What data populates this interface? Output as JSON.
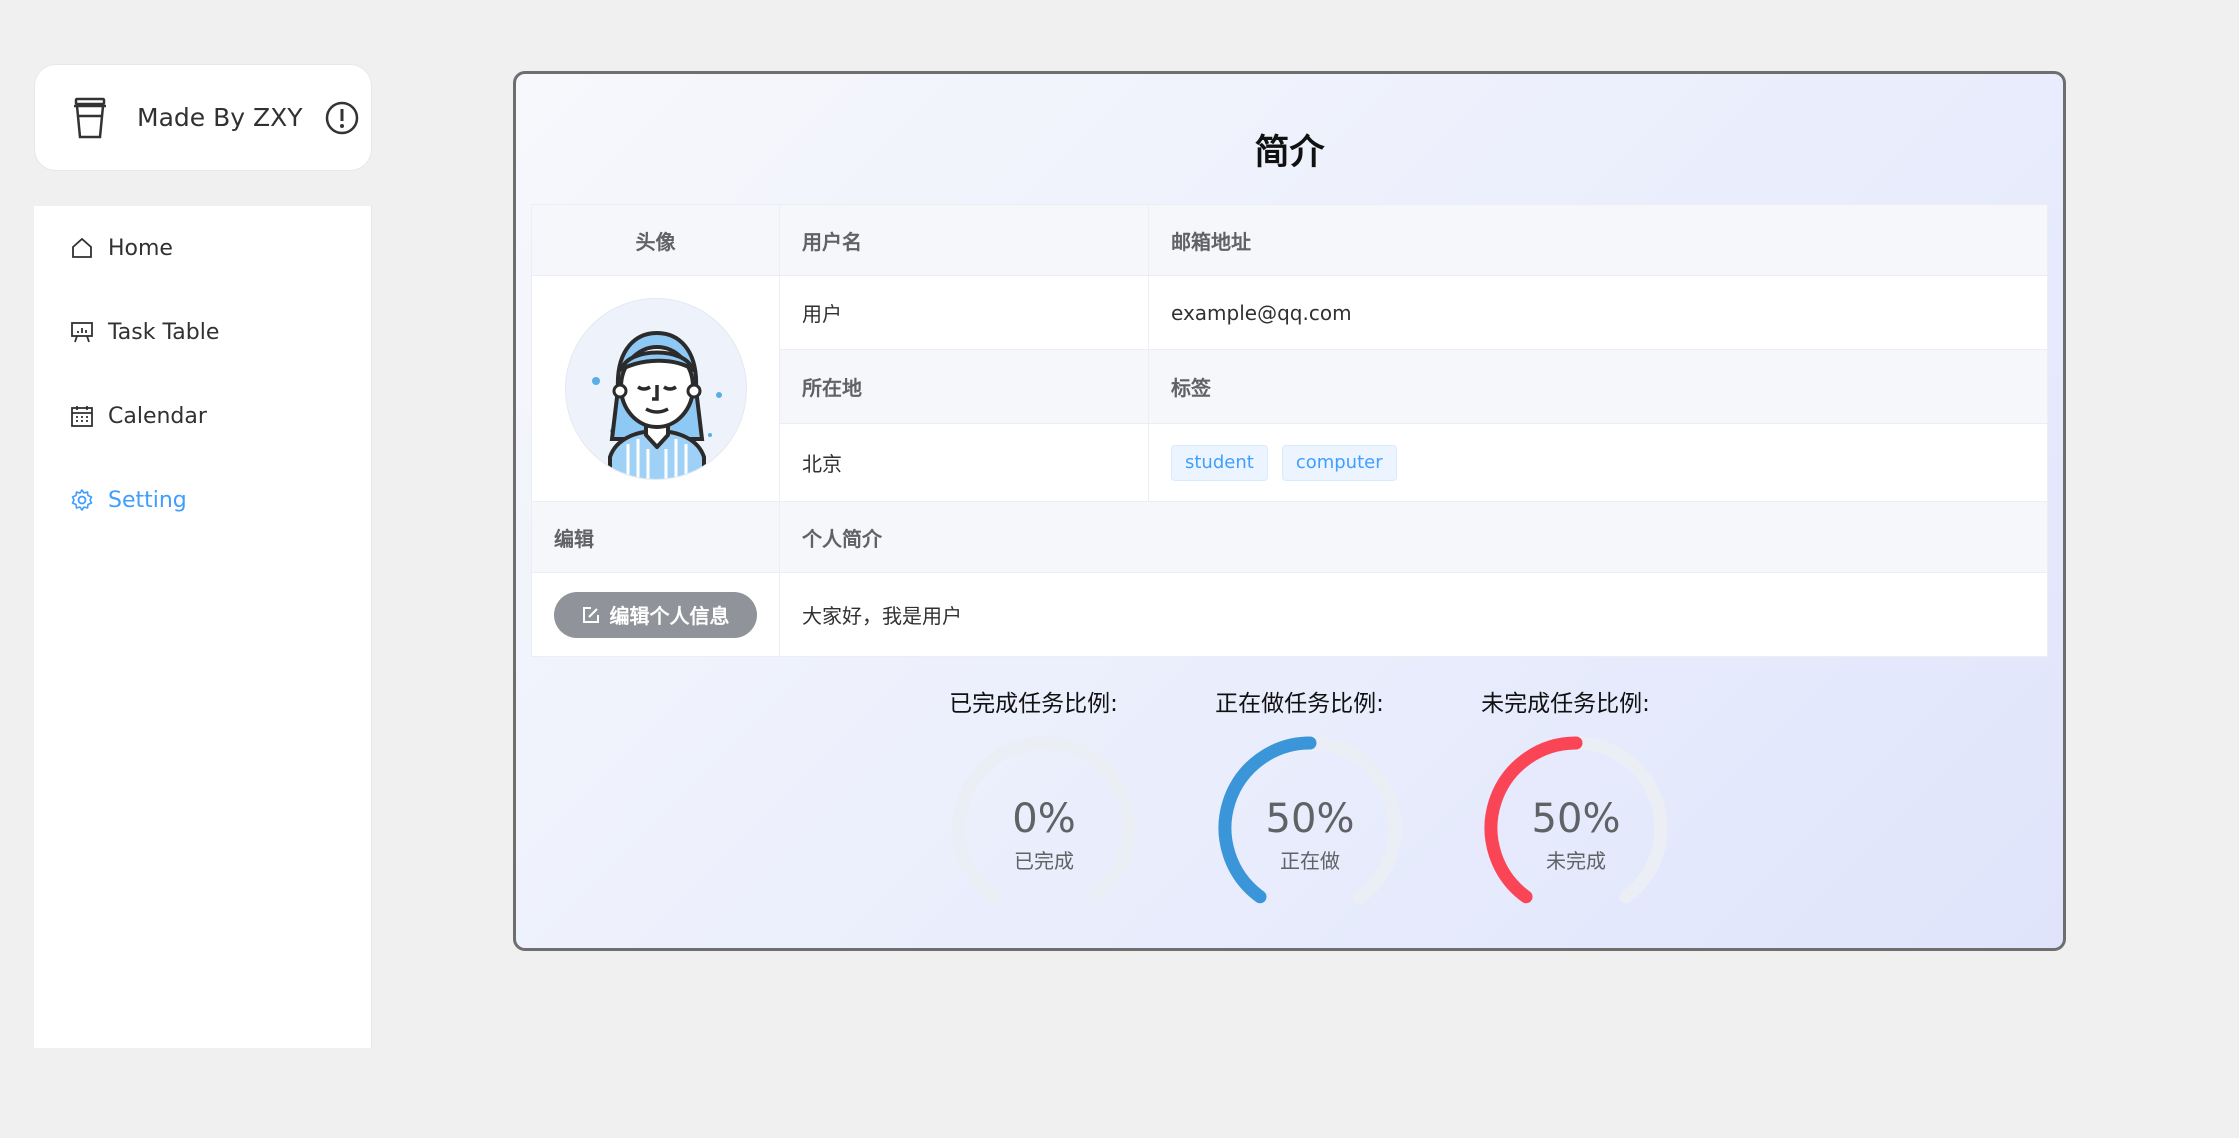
{
  "brand": {
    "text": "Made By ZXY",
    "icon": "cup-icon",
    "info_icon": "warning-circle-icon"
  },
  "menu": {
    "items": [
      {
        "label": "Home",
        "icon": "home-icon",
        "active": false
      },
      {
        "label": "Task Table",
        "icon": "presentation-icon",
        "active": false
      },
      {
        "label": "Calendar",
        "icon": "calendar-icon",
        "active": false
      },
      {
        "label": "Setting",
        "icon": "gear-icon",
        "active": true
      }
    ],
    "active_color": "#409eff"
  },
  "profile": {
    "title": "简介",
    "labels": {
      "avatar": "头像",
      "username": "用户名",
      "email": "邮箱地址",
      "location": "所在地",
      "tags": "标签",
      "edit": "编辑",
      "bio": "个人简介"
    },
    "values": {
      "username": "用户",
      "email": "example@qq.com",
      "location": "北京",
      "tags": [
        "student",
        "computer"
      ],
      "bio": "大家好，我是用户"
    },
    "edit_button": "编辑个人信息"
  },
  "progress": [
    {
      "label": "已完成任务比例:",
      "percent": 0,
      "text": "0%",
      "caption": "已完成",
      "color": "#409eff"
    },
    {
      "label": "正在做任务比例:",
      "percent": 50,
      "text": "50%",
      "caption": "正在做",
      "color": "#3b95d9"
    },
    {
      "label": "未完成任务比例:",
      "percent": 50,
      "text": "50%",
      "caption": "未完成",
      "color": "#f94556"
    }
  ],
  "colors": {
    "track": "#ebeef5",
    "tag_text": "#409eff",
    "button_bg": "#909399"
  }
}
